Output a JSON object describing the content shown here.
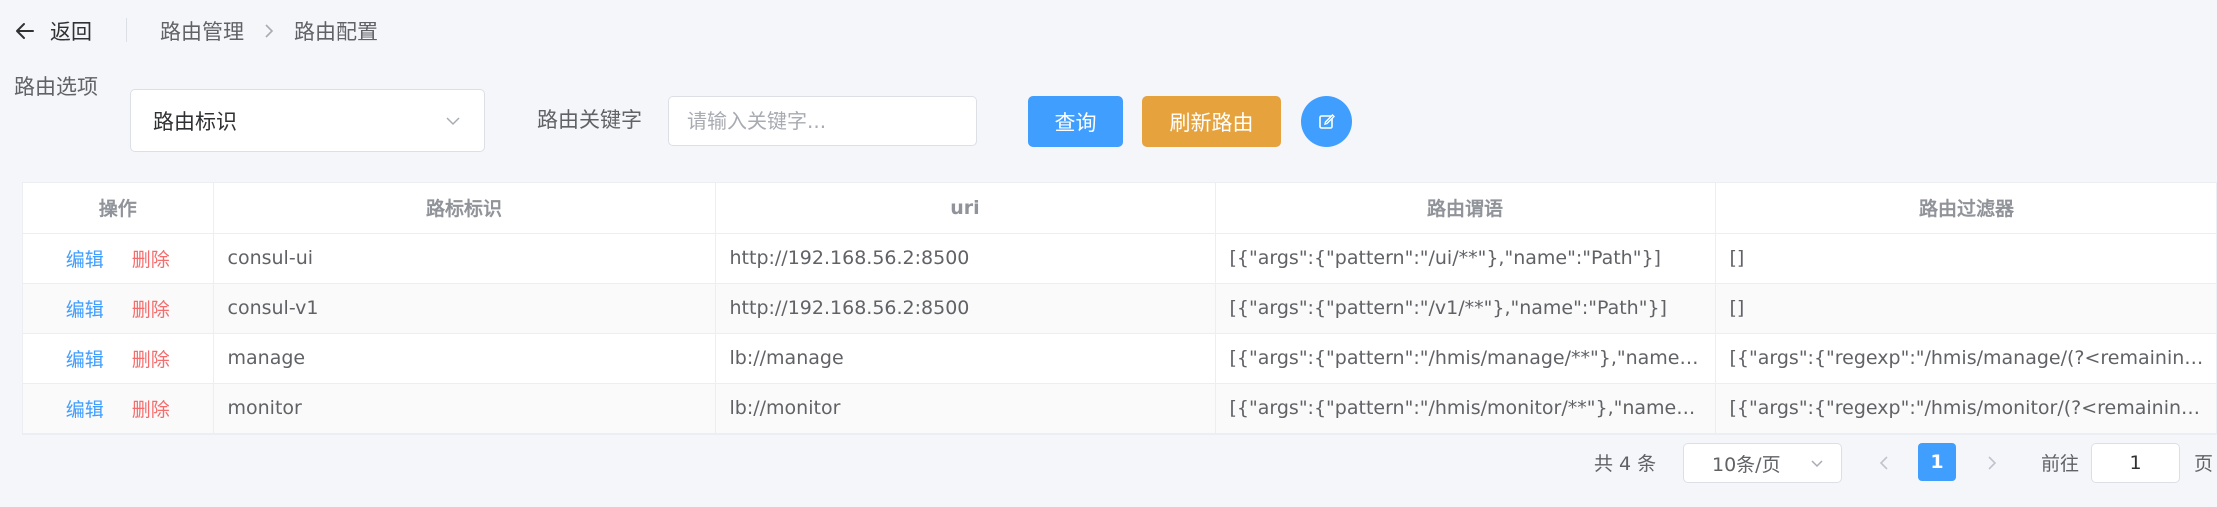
{
  "header": {
    "back_label": "返回",
    "breadcrumb": [
      "路由管理",
      "路由配置"
    ]
  },
  "filters": {
    "option_label": "路由选项",
    "option_selected": "路由标识",
    "keyword_label": "路由关键字",
    "keyword_placeholder": "请输入关键字...",
    "keyword_value": "",
    "query_label": "查询",
    "refresh_label": "刷新路由"
  },
  "table": {
    "columns": [
      "操作",
      "路标标识",
      "uri",
      "路由谓语",
      "路由过滤器"
    ],
    "edit_label": "编辑",
    "delete_label": "删除",
    "rows": [
      {
        "id": "consul-ui",
        "uri": "http://192.168.56.2:8500",
        "predicates": "[{\"args\":{\"pattern\":\"/ui/**\"},\"name\":\"Path\"}]",
        "filters": "[]"
      },
      {
        "id": "consul-v1",
        "uri": "http://192.168.56.2:8500",
        "predicates": "[{\"args\":{\"pattern\":\"/v1/**\"},\"name\":\"Path\"}]",
        "filters": "[]"
      },
      {
        "id": "manage",
        "uri": "lb://manage",
        "predicates": "[{\"args\":{\"pattern\":\"/hmis/manage/**\"},\"name\":\"Path\"}]",
        "filters": "[{\"args\":{\"regexp\":\"/hmis/manage/(?<remaining>.*)\",\"replacement\":\"/${remaining}\"},\"name\":\"RewritePath\"}]"
      },
      {
        "id": "monitor",
        "uri": "lb://monitor",
        "predicates": "[{\"args\":{\"pattern\":\"/hmis/monitor/**\"},\"name\":\"Path\"}]",
        "filters": "[{\"args\":{\"regexp\":\"/hmis/monitor/(?<remaining>.*)\",\"replacement\":\"/${remaining}\"},\"name\":\"RewritePath\"}]"
      }
    ]
  },
  "pagination": {
    "total_text": "共 4 条",
    "page_size": "10条/页",
    "current_page": "1",
    "goto_label": "前往",
    "goto_value": "1",
    "page_suffix": "页"
  },
  "colors": {
    "primary": "#409eff",
    "warning": "#e6a23c",
    "danger": "#f56c6c"
  },
  "icons": [
    "back-arrow-icon",
    "breadcrumb-chevron-icon",
    "chevron-down-icon",
    "edit-icon",
    "prev-page-icon",
    "next-page-icon"
  ]
}
